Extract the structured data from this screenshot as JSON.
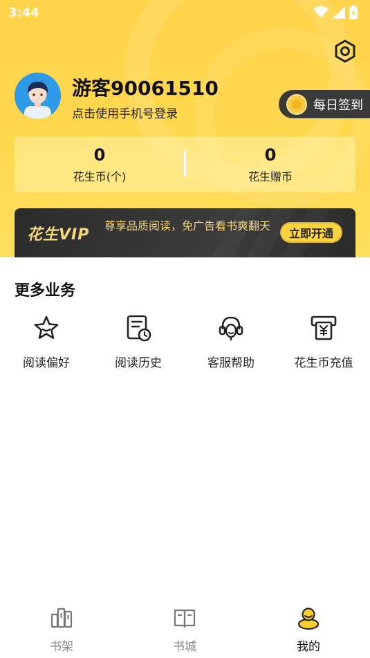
{
  "status_bar": {
    "time": "3:44"
  },
  "profile": {
    "username": "游客90061510",
    "login_prompt": "点击使用手机号登录",
    "checkin_label": "每日签到"
  },
  "stats": [
    {
      "value": "0",
      "label": "花生币(个)"
    },
    {
      "value": "0",
      "label": "花生赠币"
    }
  ],
  "vip": {
    "logo": "花生VIP",
    "description": "尊享品质阅读，免广告看书爽翻天",
    "button": "立即开通"
  },
  "more_services": {
    "title": "更多业务",
    "items": [
      {
        "label": "阅读偏好",
        "icon": "star-icon"
      },
      {
        "label": "阅读历史",
        "icon": "history-icon"
      },
      {
        "label": "客服帮助",
        "icon": "headset-icon"
      },
      {
        "label": "花生币充值",
        "icon": "recharge-icon"
      }
    ]
  },
  "bottom_nav": {
    "items": [
      {
        "label": "书架",
        "icon": "bookshelf-icon",
        "active": false
      },
      {
        "label": "书城",
        "icon": "book-open-icon",
        "active": false
      },
      {
        "label": "我的",
        "icon": "user-icon",
        "active": true
      }
    ]
  },
  "colors": {
    "brand_yellow": "#ffd84f",
    "dark": "#3a3a3a",
    "vip_gold": "#f2d27b"
  }
}
